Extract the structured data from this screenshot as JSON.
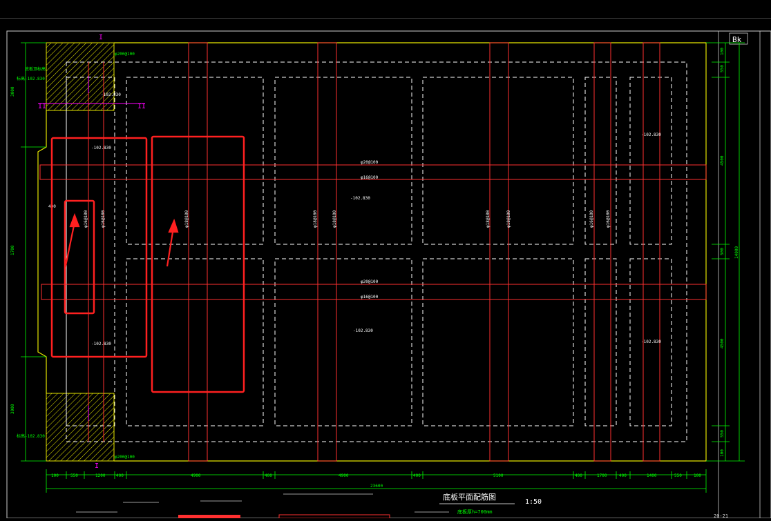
{
  "app": {
    "title": ""
  },
  "drawing": {
    "title": "底板平面配筋图",
    "scale": "1:50",
    "thickness_note": "底板厚h=700mm",
    "sheet_number": "20-21",
    "overall_width": "23600",
    "overall_height": "14000",
    "bottom_dims": [
      "100",
      "550",
      "1200",
      "400",
      "4900",
      "400",
      "4900",
      "400",
      "5100",
      "400",
      "1700",
      "400",
      "1400",
      "550",
      "100"
    ],
    "right_dims": [
      "100",
      "550",
      "4500",
      "500",
      "4500",
      "550",
      "100"
    ],
    "left_dims": [
      "3000",
      "1700",
      "3000"
    ],
    "left_labels": [
      "底板顶标高",
      "标高-102.830",
      "标高-102.830"
    ],
    "labels": {
      "rebar_top_h1": "φ20@100",
      "rebar_top_h2": "φ16@100",
      "rebar_mid_h1": "φ20@100",
      "rebar_mid_h2": "φ16@100",
      "rebar_v1": "φ16@100",
      "rebar_v2": "φ16@100",
      "rebar_v3": "φ18@100",
      "rebar_v4": "φ18@100",
      "rebar_v5": "φ18@100",
      "rebar_v6": "φ18@100",
      "rebar_v7": "φ18@100",
      "rebar_v8": "φ16@100",
      "rebar_v9": "φ16@100",
      "elev_tag_1": "-102.830",
      "elev_tag_2": "-102.830",
      "elev_tag_3": "-102.830",
      "elev_tag_4": "-102.830",
      "elev_tag_5": "-102.830",
      "elev_tag_6": "-102.830",
      "elev_tag_7": "-102.830",
      "section_I_top": "I",
      "section_I_bottom": "I",
      "section_II_left": "II",
      "section_II_right": "II",
      "corner_note_top": "φ200@100",
      "corner_note_bottom": "φ200@100",
      "corner_tag": "Bk",
      "left_tag": "400"
    }
  },
  "colors": {
    "outline": "#e6e600",
    "dashed": "#ffffff",
    "rebar": "#ff3030",
    "dim": "#00ff00",
    "annotation_box": "#ff2020",
    "section": "#ff00ff"
  }
}
